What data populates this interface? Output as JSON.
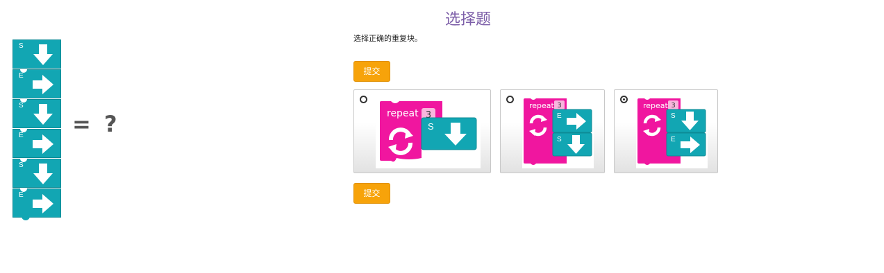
{
  "question": {
    "title": "选择题",
    "instruction": "选择正确的重复块。",
    "submit_top_label": "提交",
    "submit_bottom_label": "提交",
    "equals_text": "= ?"
  },
  "sequence": [
    {
      "letter": "S",
      "icon": "arrow-down-icon"
    },
    {
      "letter": "E",
      "icon": "arrow-right-icon"
    },
    {
      "letter": "S",
      "icon": "arrow-down-icon"
    },
    {
      "letter": "E",
      "icon": "arrow-right-icon"
    },
    {
      "letter": "S",
      "icon": "arrow-down-icon"
    },
    {
      "letter": "E",
      "icon": "arrow-right-icon"
    }
  ],
  "options": [
    {
      "repeat_word": "repeat",
      "repeat_count": "3",
      "inner": [
        {
          "letter": "S",
          "icon": "arrow-down-icon"
        }
      ],
      "selected": false
    },
    {
      "repeat_word": "repeat",
      "repeat_count": "3",
      "inner": [
        {
          "letter": "E",
          "icon": "arrow-right-icon"
        },
        {
          "letter": "S",
          "icon": "arrow-down-icon"
        }
      ],
      "selected": false
    },
    {
      "repeat_word": "repeat",
      "repeat_count": "3",
      "inner": [
        {
          "letter": "S",
          "icon": "arrow-down-icon"
        },
        {
          "letter": "E",
          "icon": "arrow-right-icon"
        }
      ],
      "selected": true
    }
  ],
  "colors": {
    "teal_block": "#12a6b3",
    "magenta_block": "#f0169f",
    "title": "#7c5ea8",
    "button": "#f7a30a"
  }
}
